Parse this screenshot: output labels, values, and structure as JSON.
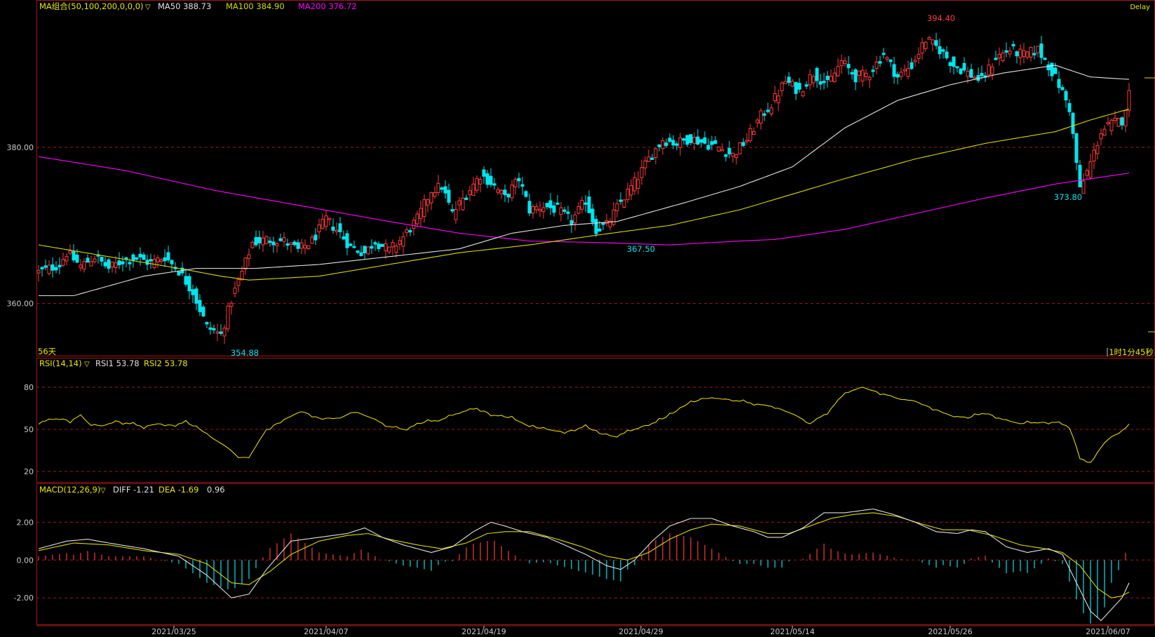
{
  "colors": {
    "up": "#ff3a3a",
    "down": "#00e5ee",
    "ma50": "#e0e0e0",
    "ma100": "#d8d800",
    "ma200": "#ff00ff",
    "rsi": "#e2d700",
    "diff": "#e0e0e0",
    "dea": "#d8d800",
    "grid": "#a01818",
    "label": "#e8e800",
    "axis_text": "#c8c8c8",
    "low_marker": "#00e5ee",
    "high_marker": "#ff3a3a"
  },
  "header": {
    "ma_title": "MA组合(50,100,200,0,0,0)",
    "ma50": "MA50 388.73",
    "ma100": "MA100 384.90",
    "ma200": "MA200 376.72",
    "delay": "Delay"
  },
  "price_panel": {
    "days_label": "56天",
    "timer": "1时1分45秒",
    "high_label": "394.40",
    "low_labels": [
      "354.88",
      "367.50",
      "373.80"
    ]
  },
  "rsi_header": {
    "title": "RSI(14,14)",
    "rsi1": "RSI1 53.78",
    "rsi2": "RSI2 53.78"
  },
  "macd_header": {
    "title": "MACD(12,26,9)",
    "diff": "DIFF -1.21",
    "dea": "DEA -1.69",
    "macd": "0.96"
  },
  "x_dates": [
    "2021/03/25",
    "2021/04/07",
    "2021/04/19",
    "2021/04/29",
    "2021/05/14",
    "2021/05/26",
    "2021/06/07"
  ],
  "chart_data": [
    {
      "type": "candlestick",
      "title": "MA组合(50,100,200,0,0,0)",
      "y_ticks": [
        360,
        380
      ],
      "y_tick_labels": [
        "360.00",
        "380.00"
      ],
      "ylim": [
        353.5,
        396.7
      ],
      "x_tick_labels": [
        "2021/03/25",
        "2021/04/07",
        "2021/04/19",
        "2021/04/29",
        "2021/05/14",
        "2021/05/26",
        "2021/06/07"
      ],
      "annotations": [
        {
          "text": "394.40",
          "value": 394.4,
          "kind": "high"
        },
        {
          "text": "354.88",
          "value": 354.88,
          "kind": "low"
        },
        {
          "text": "367.50",
          "value": 367.5,
          "kind": "low"
        },
        {
          "text": "373.80",
          "value": 373.8,
          "kind": "low"
        }
      ],
      "anchors": [
        [
          0,
          364.0
        ],
        [
          6,
          365.0
        ],
        [
          8,
          366.5
        ],
        [
          12,
          364.8
        ],
        [
          16,
          366.0
        ],
        [
          20,
          364.5
        ],
        [
          24,
          365.5
        ],
        [
          28,
          365.8
        ],
        [
          32,
          365.2
        ],
        [
          36,
          366.0
        ],
        [
          40,
          364.2
        ],
        [
          44,
          361.5
        ],
        [
          48,
          357.0
        ],
        [
          52,
          356.0
        ],
        [
          55,
          360.5
        ],
        [
          58,
          364.0
        ],
        [
          61,
          367.8
        ],
        [
          65,
          368.2
        ],
        [
          70,
          368.0
        ],
        [
          74,
          366.8
        ],
        [
          78,
          368.0
        ],
        [
          82,
          370.8
        ],
        [
          86,
          369.0
        ],
        [
          89,
          367.2
        ],
        [
          93,
          366.5
        ],
        [
          96,
          368.0
        ],
        [
          100,
          366.8
        ],
        [
          104,
          368.5
        ],
        [
          108,
          370.8
        ],
        [
          112,
          374.5
        ],
        [
          115,
          375.0
        ],
        [
          118,
          371.5
        ],
        [
          122,
          374.0
        ],
        [
          126,
          376.5
        ],
        [
          129,
          375.5
        ],
        [
          133,
          373.5
        ],
        [
          137,
          376.0
        ],
        [
          140,
          372.0
        ],
        [
          144,
          372.5
        ],
        [
          148,
          372.0
        ],
        [
          152,
          370.5
        ],
        [
          156,
          373.2
        ],
        [
          159,
          369.5
        ],
        [
          162,
          370.0
        ],
        [
          166,
          373.0
        ],
        [
          170,
          375.5
        ],
        [
          174,
          378.5
        ],
        [
          178,
          381.0
        ],
        [
          182,
          380.5
        ],
        [
          186,
          381.2
        ],
        [
          190,
          380.5
        ],
        [
          194,
          380.0
        ],
        [
          198,
          379.0
        ],
        [
          202,
          381.0
        ],
        [
          206,
          384.0
        ],
        [
          209,
          385.5
        ],
        [
          213,
          388.5
        ],
        [
          217,
          387.2
        ],
        [
          221,
          389.5
        ],
        [
          225,
          388.0
        ],
        [
          229,
          391.0
        ],
        [
          233,
          389.0
        ],
        [
          237,
          389.5
        ],
        [
          241,
          392.0
        ],
        [
          245,
          389.0
        ],
        [
          249,
          390.5
        ],
        [
          253,
          393.8
        ],
        [
          257,
          392.5
        ],
        [
          261,
          390.5
        ],
        [
          265,
          389.5
        ],
        [
          269,
          388.5
        ],
        [
          273,
          391.5
        ],
        [
          277,
          392.5
        ],
        [
          281,
          391.8
        ],
        [
          285,
          392.5
        ],
        [
          288,
          390.5
        ],
        [
          291,
          388.0
        ],
        [
          294,
          385.0
        ],
        [
          297,
          374.5
        ],
        [
          300,
          378.0
        ],
        [
          303,
          382.0
        ],
        [
          306,
          383.0
        ],
        [
          309,
          383.5
        ],
        [
          311,
          386.8
        ]
      ],
      "ma50_anchors": [
        [
          0,
          361.0
        ],
        [
          10,
          361.0
        ],
        [
          30,
          363.5
        ],
        [
          45,
          364.5
        ],
        [
          62,
          364.5
        ],
        [
          80,
          365.0
        ],
        [
          100,
          366.0
        ],
        [
          120,
          367.0
        ],
        [
          135,
          369.0
        ],
        [
          150,
          370.0
        ],
        [
          165,
          370.5
        ],
        [
          185,
          373.0
        ],
        [
          200,
          375.0
        ],
        [
          215,
          377.5
        ],
        [
          230,
          382.5
        ],
        [
          245,
          386.0
        ],
        [
          260,
          388.0
        ],
        [
          275,
          389.5
        ],
        [
          290,
          390.5
        ],
        [
          300,
          389.0
        ],
        [
          311,
          388.7
        ]
      ],
      "ma100_anchors": [
        [
          0,
          367.5
        ],
        [
          20,
          366.0
        ],
        [
          40,
          364.5
        ],
        [
          52,
          363.5
        ],
        [
          60,
          363.0
        ],
        [
          80,
          363.5
        ],
        [
          100,
          365.0
        ],
        [
          120,
          366.5
        ],
        [
          140,
          367.5
        ],
        [
          160,
          368.8
        ],
        [
          180,
          370.0
        ],
        [
          200,
          372.0
        ],
        [
          215,
          374.0
        ],
        [
          230,
          376.0
        ],
        [
          250,
          378.5
        ],
        [
          270,
          380.5
        ],
        [
          290,
          382.0
        ],
        [
          300,
          383.5
        ],
        [
          311,
          384.9
        ]
      ],
      "ma200_anchors": [
        [
          0,
          378.8
        ],
        [
          25,
          377.0
        ],
        [
          50,
          374.5
        ],
        [
          75,
          372.5
        ],
        [
          100,
          370.5
        ],
        [
          120,
          369.0
        ],
        [
          140,
          368.0
        ],
        [
          160,
          367.8
        ],
        [
          180,
          367.5
        ],
        [
          200,
          368.0
        ],
        [
          210,
          368.2
        ],
        [
          230,
          369.5
        ],
        [
          250,
          371.5
        ],
        [
          270,
          373.5
        ],
        [
          290,
          375.3
        ],
        [
          311,
          376.7
        ]
      ]
    },
    {
      "type": "line",
      "title": "RSI(14,14)",
      "y_ticks": [
        20,
        50,
        80
      ],
      "ylim": [
        13,
        92
      ],
      "series": [
        {
          "name": "RSI1",
          "last": 53.78
        },
        {
          "name": "RSI2",
          "last": 53.78
        }
      ],
      "anchors": [
        [
          0,
          55
        ],
        [
          6,
          58
        ],
        [
          9,
          56
        ],
        [
          12,
          60
        ],
        [
          14,
          55
        ],
        [
          18,
          52
        ],
        [
          22,
          56
        ],
        [
          26,
          54
        ],
        [
          30,
          52
        ],
        [
          34,
          54
        ],
        [
          38,
          53
        ],
        [
          42,
          55
        ],
        [
          46,
          50
        ],
        [
          50,
          43
        ],
        [
          54,
          37
        ],
        [
          57,
          30
        ],
        [
          60,
          30
        ],
        [
          62,
          38
        ],
        [
          65,
          50
        ],
        [
          70,
          57
        ],
        [
          75,
          63
        ],
        [
          80,
          58
        ],
        [
          86,
          58
        ],
        [
          90,
          63
        ],
        [
          95,
          58
        ],
        [
          100,
          52
        ],
        [
          104,
          50
        ],
        [
          110,
          55
        ],
        [
          115,
          57
        ],
        [
          120,
          62
        ],
        [
          125,
          65
        ],
        [
          130,
          60
        ],
        [
          135,
          58
        ],
        [
          140,
          52
        ],
        [
          145,
          50
        ],
        [
          150,
          48
        ],
        [
          156,
          52
        ],
        [
          160,
          47
        ],
        [
          164,
          45
        ],
        [
          168,
          48
        ],
        [
          172,
          52
        ],
        [
          176,
          55
        ],
        [
          180,
          60
        ],
        [
          185,
          68
        ],
        [
          190,
          72
        ],
        [
          195,
          72
        ],
        [
          200,
          70
        ],
        [
          205,
          68
        ],
        [
          210,
          66
        ],
        [
          216,
          60
        ],
        [
          220,
          54
        ],
        [
          225,
          62
        ],
        [
          230,
          76
        ],
        [
          235,
          80
        ],
        [
          240,
          76
        ],
        [
          245,
          72
        ],
        [
          250,
          70
        ],
        [
          255,
          65
        ],
        [
          260,
          60
        ],
        [
          265,
          58
        ],
        [
          270,
          62
        ],
        [
          275,
          57
        ],
        [
          280,
          54
        ],
        [
          285,
          55
        ],
        [
          290,
          55
        ],
        [
          294,
          52
        ],
        [
          297,
          30
        ],
        [
          300,
          25
        ],
        [
          303,
          38
        ],
        [
          306,
          45
        ],
        [
          309,
          48
        ],
        [
          311,
          53.8
        ]
      ]
    },
    {
      "type": "bar+line",
      "title": "MACD(12,26,9)",
      "y_ticks": [
        -2,
        0,
        2
      ],
      "y_tick_labels": [
        "-2.00",
        "0.00",
        "2.00"
      ],
      "ylim": [
        -3.4,
        3.2
      ],
      "series": [
        {
          "name": "DIFF",
          "last": -1.21
        },
        {
          "name": "DEA",
          "last": -1.69
        },
        {
          "name": "MACD",
          "last": 0.96
        }
      ],
      "diff_anchors": [
        [
          0,
          0.6
        ],
        [
          8,
          1.0
        ],
        [
          14,
          1.1
        ],
        [
          20,
          0.9
        ],
        [
          30,
          0.6
        ],
        [
          40,
          0.2
        ],
        [
          48,
          -0.8
        ],
        [
          55,
          -2.0
        ],
        [
          60,
          -1.8
        ],
        [
          65,
          -0.5
        ],
        [
          72,
          1.0
        ],
        [
          80,
          1.2
        ],
        [
          88,
          1.4
        ],
        [
          93,
          1.7
        ],
        [
          98,
          1.2
        ],
        [
          104,
          0.8
        ],
        [
          112,
          0.4
        ],
        [
          118,
          0.7
        ],
        [
          124,
          1.5
        ],
        [
          129,
          2.0
        ],
        [
          133,
          1.8
        ],
        [
          138,
          1.5
        ],
        [
          145,
          1.2
        ],
        [
          150,
          0.8
        ],
        [
          156,
          0.3
        ],
        [
          162,
          -0.3
        ],
        [
          166,
          -0.5
        ],
        [
          170,
          0.0
        ],
        [
          175,
          1.0
        ],
        [
          180,
          1.8
        ],
        [
          186,
          2.2
        ],
        [
          192,
          2.2
        ],
        [
          198,
          1.8
        ],
        [
          204,
          1.5
        ],
        [
          208,
          1.2
        ],
        [
          212,
          1.2
        ],
        [
          218,
          1.7
        ],
        [
          224,
          2.5
        ],
        [
          230,
          2.5
        ],
        [
          238,
          2.7
        ],
        [
          244,
          2.4
        ],
        [
          250,
          2.0
        ],
        [
          256,
          1.5
        ],
        [
          262,
          1.4
        ],
        [
          266,
          1.6
        ],
        [
          270,
          1.5
        ],
        [
          276,
          0.7
        ],
        [
          282,
          0.4
        ],
        [
          288,
          0.6
        ],
        [
          292,
          0.3
        ],
        [
          296,
          -1.2
        ],
        [
          300,
          -2.7
        ],
        [
          303,
          -3.2
        ],
        [
          306,
          -2.6
        ],
        [
          309,
          -2.0
        ],
        [
          311,
          -1.21
        ]
      ],
      "dea_anchors": [
        [
          0,
          0.5
        ],
        [
          10,
          0.9
        ],
        [
          20,
          0.8
        ],
        [
          30,
          0.5
        ],
        [
          40,
          0.3
        ],
        [
          48,
          -0.2
        ],
        [
          55,
          -1.2
        ],
        [
          60,
          -1.3
        ],
        [
          66,
          -0.6
        ],
        [
          72,
          0.3
        ],
        [
          80,
          1.0
        ],
        [
          88,
          1.3
        ],
        [
          94,
          1.4
        ],
        [
          100,
          1.1
        ],
        [
          108,
          0.8
        ],
        [
          115,
          0.6
        ],
        [
          122,
          0.9
        ],
        [
          128,
          1.4
        ],
        [
          133,
          1.5
        ],
        [
          140,
          1.5
        ],
        [
          148,
          1.1
        ],
        [
          155,
          0.7
        ],
        [
          162,
          0.2
        ],
        [
          168,
          0.0
        ],
        [
          174,
          0.4
        ],
        [
          180,
          1.1
        ],
        [
          186,
          1.6
        ],
        [
          192,
          1.9
        ],
        [
          200,
          1.8
        ],
        [
          208,
          1.4
        ],
        [
          214,
          1.4
        ],
        [
          220,
          1.8
        ],
        [
          226,
          2.2
        ],
        [
          232,
          2.4
        ],
        [
          238,
          2.5
        ],
        [
          245,
          2.3
        ],
        [
          252,
          1.9
        ],
        [
          258,
          1.6
        ],
        [
          265,
          1.6
        ],
        [
          272,
          1.3
        ],
        [
          280,
          0.8
        ],
        [
          287,
          0.6
        ],
        [
          292,
          0.4
        ],
        [
          297,
          -0.3
        ],
        [
          302,
          -1.5
        ],
        [
          306,
          -2.0
        ],
        [
          309,
          -1.9
        ],
        [
          311,
          -1.69
        ]
      ]
    }
  ]
}
